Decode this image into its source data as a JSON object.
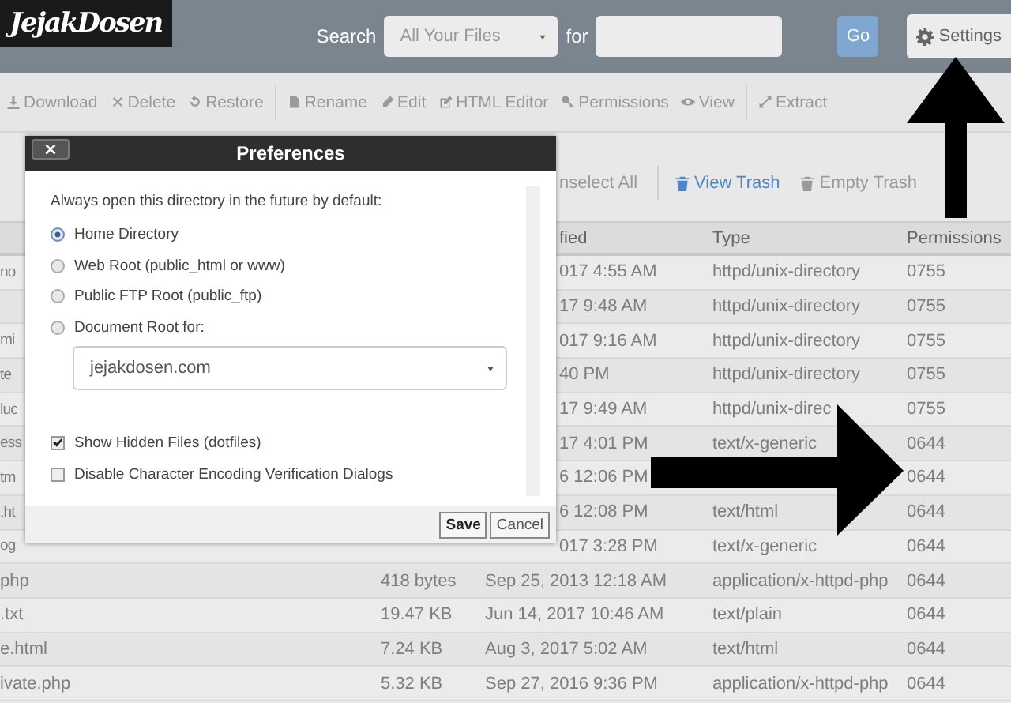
{
  "header": {
    "logo": "JejakDosen",
    "search_label": "Search",
    "scope": "All Your Files",
    "for_label": "for",
    "go": "Go",
    "settings": "Settings"
  },
  "toolbar": [
    [
      {
        "label": "Download",
        "disabled": true
      },
      {
        "label": "Delete",
        "disabled": true
      },
      {
        "label": "Restore",
        "disabled": true
      }
    ],
    [
      {
        "label": "Rename",
        "disabled": true
      },
      {
        "label": "Edit",
        "disabled": true
      },
      {
        "label": "HTML Editor",
        "disabled": true
      },
      {
        "label": "Permissions",
        "disabled": true
      },
      {
        "label": "View",
        "disabled": true
      }
    ],
    [
      {
        "label": "Extract",
        "disabled": true
      }
    ]
  ],
  "toolbar2": [
    {
      "label": "nselect All",
      "disabled": true
    },
    {
      "label": "View Trash",
      "disabled": false
    },
    {
      "label": "Empty Trash",
      "disabled": true
    }
  ],
  "table": {
    "columns": [
      "fied",
      "Type",
      "Permissions"
    ],
    "rows": [
      {
        "name": "no",
        "modified": "017 4:55 AM",
        "type": "httpd/unix-directory",
        "permissions": "0755"
      },
      {
        "name": "",
        "modified": "17 9:48 AM",
        "type": "httpd/unix-directory",
        "permissions": "0755"
      },
      {
        "name": "mi",
        "modified": "017 9:16 AM",
        "type": "httpd/unix-directory",
        "permissions": "0755"
      },
      {
        "name": "te",
        "modified": "40 PM",
        "type": "httpd/unix-directory",
        "permissions": "0755"
      },
      {
        "name": "luc",
        "modified": "17 9:49 AM",
        "type": "httpd/unix-direc",
        "permissions": "0755"
      },
      {
        "name": "ess",
        "modified": "17 4:01 PM",
        "type": "text/x-generic",
        "permissions": "0644"
      },
      {
        "name": "tm",
        "modified": "6 12:06 PM",
        "type": "",
        "permissions": "0644"
      },
      {
        "name": ".ht",
        "modified": "6 12:08 PM",
        "type": "text/html",
        "permissions": "0644"
      },
      {
        "name": "og",
        "modified": "017 3:28 PM",
        "type": "text/x-generic",
        "permissions": "0644"
      },
      {
        "name": "php",
        "size": "418 bytes",
        "modified": "Sep 25, 2013 12:18 AM",
        "type": "application/x-httpd-php",
        "permissions": "0644"
      },
      {
        "name": ".txt",
        "size": "19.47 KB",
        "modified": "Jun 14, 2017 10:46 AM",
        "type": "text/plain",
        "permissions": "0644"
      },
      {
        "name": "e.html",
        "size": "7.24 KB",
        "modified": "Aug 3, 2017 5:02 AM",
        "type": "text/html",
        "permissions": "0644"
      },
      {
        "name": "ivate.php",
        "size": "5.32 KB",
        "modified": "Sep 27, 2016 9:36 PM",
        "type": "application/x-httpd-php",
        "permissions": "0644"
      }
    ]
  },
  "dialog": {
    "title": "Preferences",
    "close": "×",
    "prompt": "Always open this directory in the future by default:",
    "options": [
      {
        "label": "Home Directory",
        "selected": true
      },
      {
        "label": "Web Root (public_html or www)",
        "selected": false
      },
      {
        "label": "Public FTP Root (public_ftp)",
        "selected": false
      },
      {
        "label": "Document Root for:",
        "selected": false
      }
    ],
    "domain": "jejakdosen.com",
    "checks": [
      {
        "label": "Show Hidden Files (dotfiles)",
        "checked": true
      },
      {
        "label": "Disable Character Encoding Verification Dialogs",
        "checked": false
      }
    ],
    "buttons": [
      "Save",
      "Cancel"
    ]
  }
}
